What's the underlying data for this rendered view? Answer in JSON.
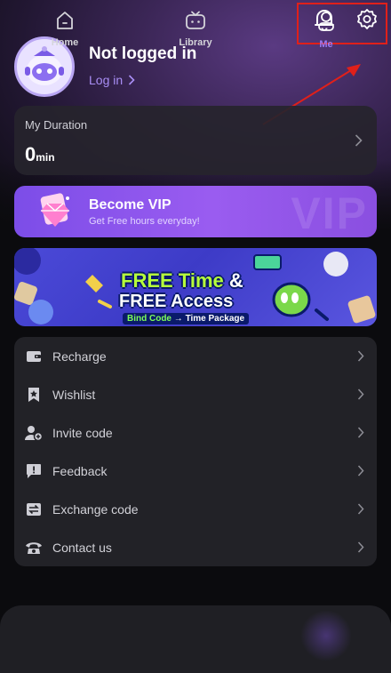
{
  "header": {
    "notification_icon": "bell-icon",
    "settings_icon": "gear-icon"
  },
  "profile": {
    "username": "Not logged in",
    "login_link": "Log in"
  },
  "duration": {
    "title": "My Duration",
    "value": "0",
    "unit": "min"
  },
  "vip": {
    "title": "Become VIP",
    "subtitle": "Get Free hours everyday!",
    "watermark": "VIP"
  },
  "banner": {
    "line1_main": "FREE Time",
    "line1_amp": " &",
    "line2": "FREE Access",
    "sub_left": "Bind Code",
    "sub_arrow": " → ",
    "sub_right": "Time Package"
  },
  "menu": {
    "items": [
      {
        "label": "Recharge",
        "icon": "wallet-icon"
      },
      {
        "label": "Wishlist",
        "icon": "bookmark-star-icon"
      },
      {
        "label": "Invite code",
        "icon": "add-user-icon"
      },
      {
        "label": "Feedback",
        "icon": "feedback-icon"
      },
      {
        "label": "Exchange code",
        "icon": "exchange-icon"
      },
      {
        "label": "Contact us",
        "icon": "phone-icon"
      }
    ]
  },
  "nav": {
    "home": "Home",
    "library": "Library",
    "me": "Me"
  },
  "colors": {
    "accent": "#9b7cf6",
    "annotation": "#e0201a",
    "vip_gradient_start": "#7c4de8",
    "banner_green": "#b6ff3b"
  }
}
